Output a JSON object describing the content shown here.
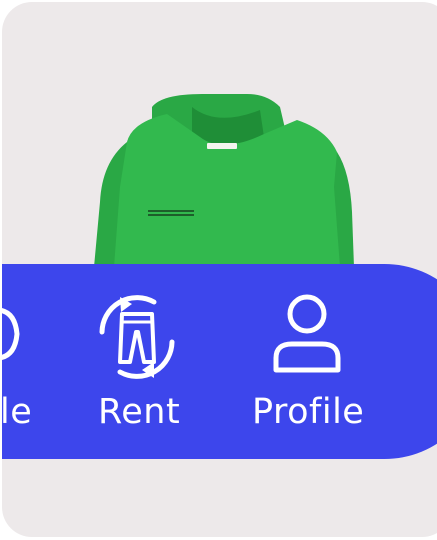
{
  "product": {
    "icon": "green-hoodie-image"
  },
  "nav": {
    "items": [
      {
        "label": "le",
        "icon": "truncated-icon"
      },
      {
        "label": "Rent",
        "icon": "pants-rotate-icon"
      },
      {
        "label": "Profile",
        "icon": "person-icon"
      }
    ]
  },
  "colors": {
    "nav_bg": "#3d46ec",
    "card_bg": "#ede9ea",
    "hoodie": "#2fb54b"
  }
}
